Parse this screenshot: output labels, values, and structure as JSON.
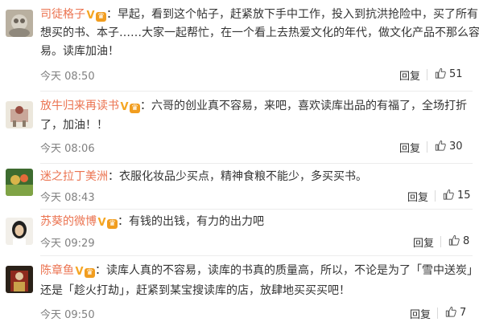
{
  "comments": [
    {
      "user": "司徒格子",
      "line1": "：早起，看到这个帖子，赶紧放下手中工作，投入到抗洪抢险中，买了所有",
      "line2": "想买的书、本子……大家一起帮忙，在一个看上去热爱文化的年代，做文化产品不那么容",
      "line3": "易。读库加油！",
      "time": "今天 08:50",
      "reply": "回复",
      "likes": "51"
    },
    {
      "user": "放牛归来再读书",
      "line1": "：六哥的创业真不容易，来吧，喜欢读库出品的有福了，全场打折",
      "line2": "了，加油！！",
      "time": "今天 08:06",
      "reply": "回复",
      "likes": "30"
    },
    {
      "user": "迷之拉丁美洲",
      "line1": "：衣服化妆品少买点，精神食粮不能少，多买买书。",
      "time": "今天 08:43",
      "reply": "回复",
      "likes": "15"
    },
    {
      "user": "苏葵的微博",
      "line1": "：有钱的出钱，有力的出力吧",
      "time": "今天 09:29",
      "reply": "回复",
      "likes": "8"
    },
    {
      "user": "陈章鱼",
      "line1": "：读库人真的不容易，读库的书真的质量高，所以，不论是为了「雪中送炭」",
      "line2": "还是「趁火打劫」，赶紧到某宝搜读库的店，放肆地买买买吧！",
      "time": "今天 09:50",
      "reply": "回复",
      "likes": "7"
    }
  ],
  "icons": {
    "verified": "verified-v-icon",
    "member": "member-crown-icon",
    "like": "thumbs-up-icon"
  },
  "colors": {
    "username": "#eb7350",
    "meta": "#808080",
    "badge": "#f19d1f"
  }
}
